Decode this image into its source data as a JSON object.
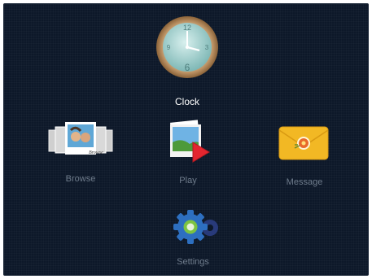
{
  "menu": {
    "items": [
      {
        "id": "clock",
        "label": "Clock",
        "icon": "clock-icon",
        "selected": true
      },
      {
        "id": "browse",
        "label": "Browse",
        "icon": "photo-stack-icon",
        "selected": false
      },
      {
        "id": "play",
        "label": "Play",
        "icon": "slideshow-play-icon",
        "selected": false
      },
      {
        "id": "message",
        "label": "Message",
        "icon": "envelope-icon",
        "selected": false
      },
      {
        "id": "settings",
        "label": "Settings",
        "icon": "gear-icon",
        "selected": false
      }
    ]
  },
  "colors": {
    "background": "#0d1829",
    "selected_label": "#ffffff",
    "label": "#6f7c8c",
    "play_accent": "#e3262f",
    "envelope": "#f2b824",
    "gear": "#2d6fc0",
    "gear_hub": "#7cc341"
  }
}
